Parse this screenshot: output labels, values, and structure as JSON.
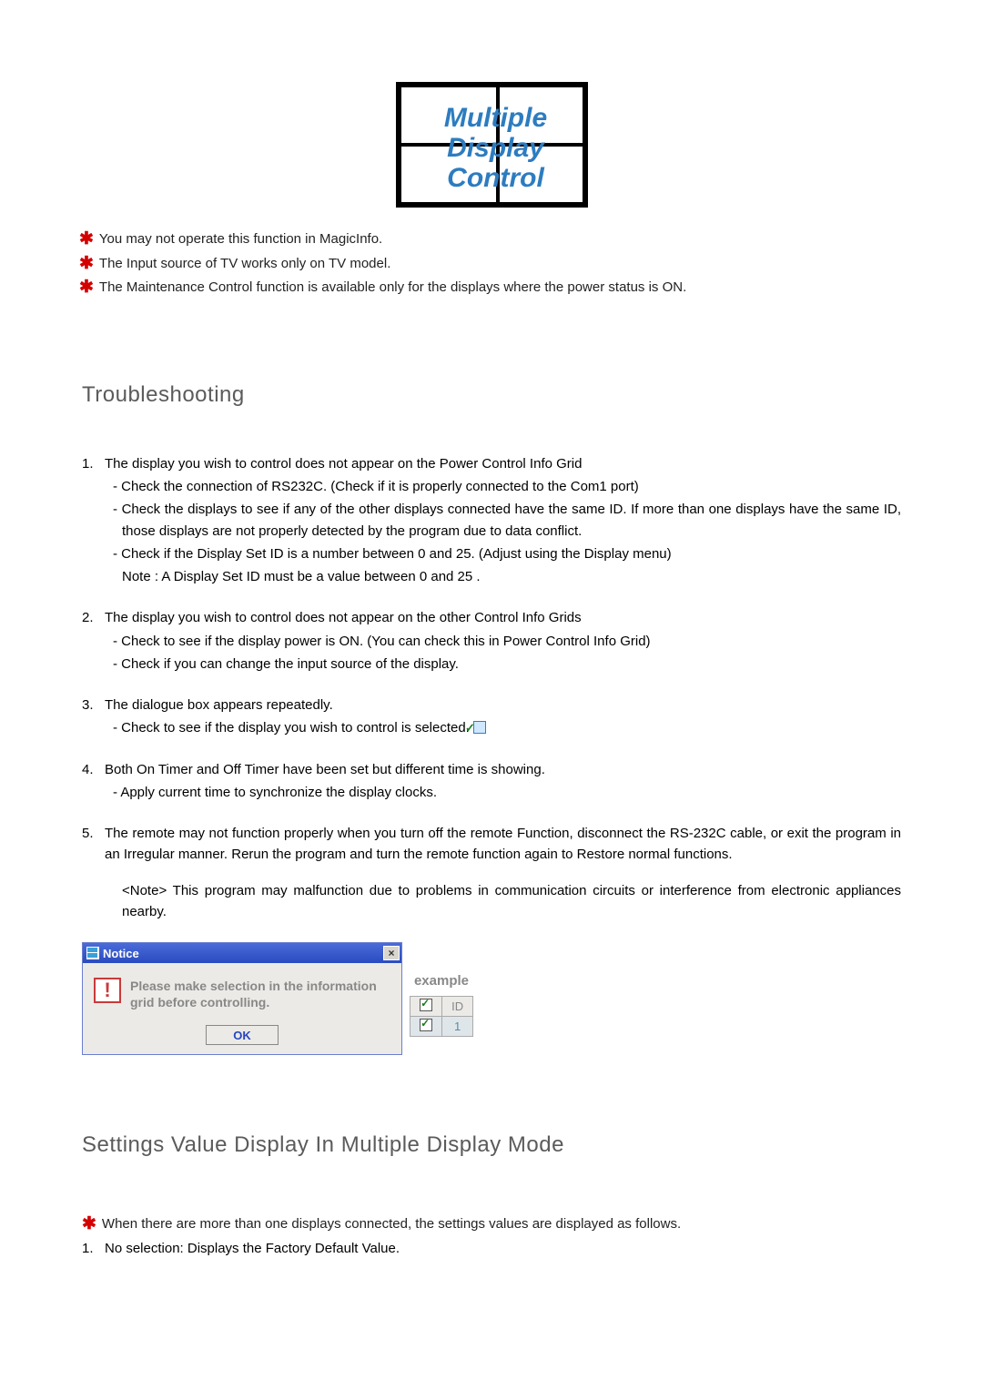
{
  "logo": {
    "line1": "Multiple",
    "line2": "Display",
    "line3": "Control"
  },
  "top_star_notes": [
    "You may not operate this function in MagicInfo.",
    "The Input source of TV works only on TV model.",
    "The Maintenance Control function is available only for the displays where the power status is ON."
  ],
  "troubleshooting": {
    "heading": "Troubleshooting",
    "items": [
      {
        "num": "1.",
        "title": "The display you wish to control does not appear on the Power Control Info Grid",
        "subs": [
          "- Check the connection of RS232C. (Check if it is properly connected to the Com1 port)",
          "- Check the displays to see if any of the other displays connected have the same ID. If more than one displays have the same ID, those displays are not properly detected by the program due to data conflict.",
          "- Check if the Display Set ID is a number between 0 and 25. (Adjust using the Display menu)"
        ],
        "note": "Note :   A Display Set ID must be a value between 0 and 25 ."
      },
      {
        "num": "2.",
        "title": "The display you wish to control does not appear on the other Control Info Grids",
        "subs": [
          "- Check to see if the display power is ON. (You can check this in Power Control Info Grid)",
          "- Check if you can change the input source of the display."
        ]
      },
      {
        "num": "3.",
        "title": "The dialogue box appears repeatedly.",
        "subs": [
          "- Check to see if the display you wish to control is selected."
        ],
        "has_checkbox_icon": true
      },
      {
        "num": "4.",
        "title": "Both On Timer and Off Timer have been set but different time is showing.",
        "subs": [
          "- Apply current time to synchronize the display clocks."
        ]
      },
      {
        "num": "5.",
        "title": "The remote may not function properly when you turn off the remote Function, disconnect the RS-232C cable, or exit the program in an Irregular manner. Rerun the program and turn the remote function again to Restore normal functions.",
        "subs": [],
        "program_note": "<Note>  This program may malfunction due to problems in communication circuits or interference from electronic appliances nearby."
      }
    ]
  },
  "dialog": {
    "title": "Notice",
    "message": "Please make selection in the information grid before controlling.",
    "ok_label": "OK",
    "close_label": "×",
    "example_label": "example",
    "example_header": "ID",
    "example_row_value": "1"
  },
  "settings_section": {
    "heading": "Settings Value Display In Multiple Display Mode",
    "star_note": "When there are more than one displays connected, the settings values are displayed as follows.",
    "numbered": [
      {
        "num": "1.",
        "text": "No selection: Displays the Factory Default Value."
      }
    ]
  }
}
